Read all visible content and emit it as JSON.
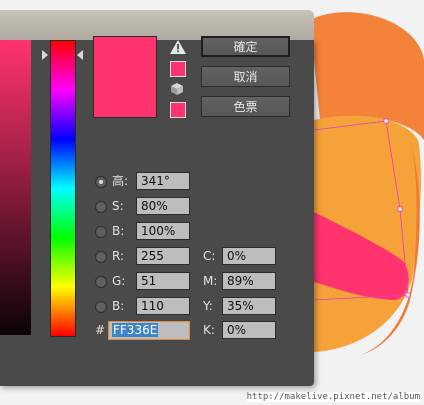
{
  "colors": {
    "selected": "#ff336e",
    "dialog_bg": "#4a4a4a",
    "field_bg": "#bdbdbd",
    "artwork_orange": "#f5a23a",
    "artwork_pink": "#ff336e"
  },
  "buttons": {
    "ok": "確定",
    "cancel": "取消",
    "swatches": "色票"
  },
  "icons": {
    "gamut_warning": "warning-triangle-icon",
    "web_safe": "cube-icon"
  },
  "fields": {
    "h": {
      "label": "高:",
      "value": "341°",
      "selected": true
    },
    "s": {
      "label": "S:",
      "value": "80%",
      "selected": false
    },
    "b": {
      "label": "B:",
      "value": "100%",
      "selected": false
    },
    "r": {
      "label": "R:",
      "value": "255",
      "selected": false
    },
    "g": {
      "label": "G:",
      "value": "51",
      "selected": false
    },
    "b2": {
      "label": "B:",
      "value": "110",
      "selected": false
    },
    "c": {
      "label": "C:",
      "value": "0%"
    },
    "m": {
      "label": "M:",
      "value": "89%"
    },
    "y": {
      "label": "Y:",
      "value": "35%"
    },
    "k": {
      "label": "K:",
      "value": "0%"
    },
    "hex": {
      "label": "#",
      "value": "FF336E"
    }
  },
  "watermark": "http://makelive.pixnet.net/album"
}
